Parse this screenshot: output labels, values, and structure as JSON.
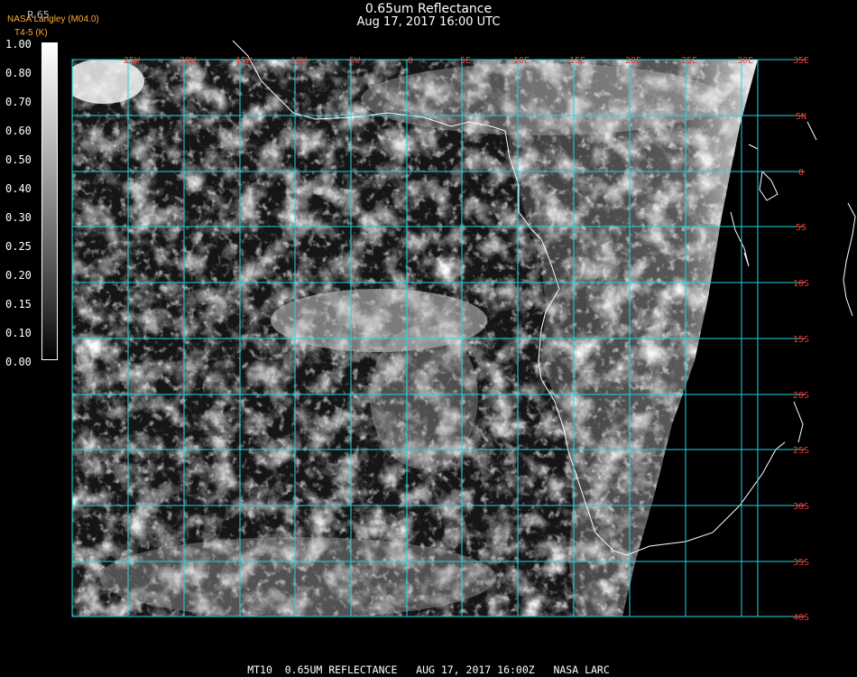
{
  "header": {
    "title": "0.65um Reflectance",
    "datetime": "Aug 17, 2017 16:00 UTC",
    "credit": "NASA Langley (M04.0)",
    "model_note": "T4-5 (K)"
  },
  "colorbar": {
    "label": "R.65",
    "ticks": [
      "1.00",
      "0.80",
      "0.70",
      "0.60",
      "0.50",
      "0.40",
      "0.30",
      "0.25",
      "0.20",
      "0.15",
      "0.10",
      "0.00"
    ]
  },
  "map": {
    "longitude_labels": [
      "25W",
      "20W",
      "15W",
      "10W",
      "5W",
      "0",
      "5E",
      "10E",
      "15E",
      "20E",
      "25E",
      "30E"
    ],
    "latitude_labels": [
      "35E",
      "5N",
      "0",
      "5S",
      "10S",
      "15S",
      "20S",
      "25S",
      "30S",
      "35S",
      "40S"
    ],
    "gridline_color": "#20d8e0",
    "label_color": "#ff3030"
  },
  "footer": {
    "text": "MT10  0.65UM REFLECTANCE   AUG 17, 2017 16:00Z   NASA LARC"
  }
}
